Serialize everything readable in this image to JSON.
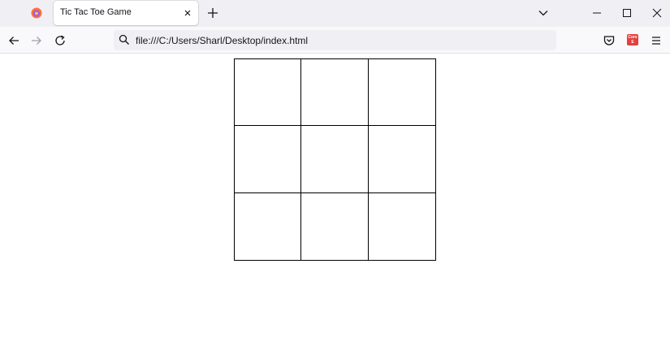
{
  "browser": {
    "tab": {
      "title": "Tic Tac Toe Game"
    },
    "url": "file:///C:/Users/Sharl/Desktop/index.html",
    "extension_badge": "Cors\nE"
  },
  "board": {
    "cells": [
      "",
      "",
      "",
      "",
      "",
      "",
      "",
      "",
      ""
    ]
  }
}
